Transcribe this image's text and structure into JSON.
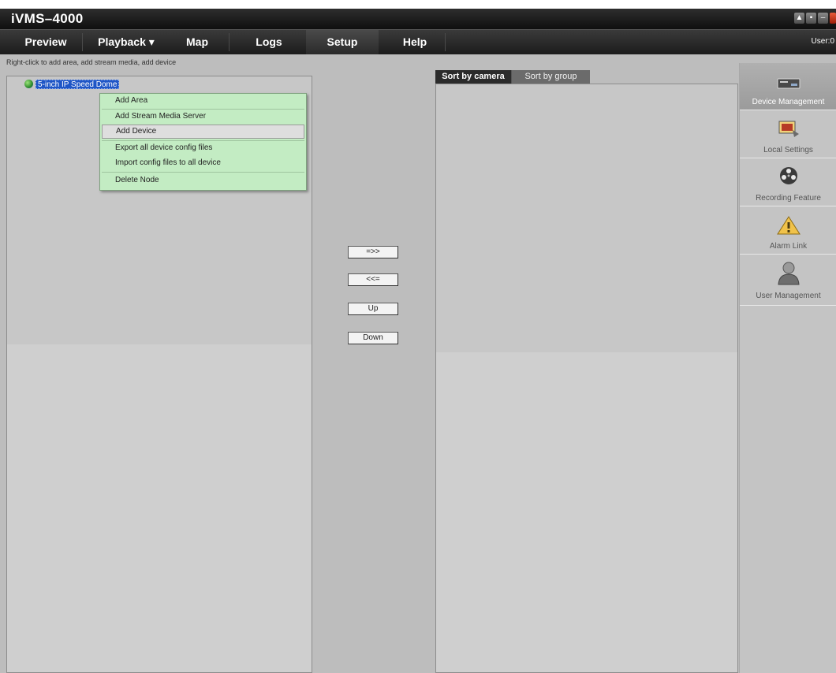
{
  "app": {
    "title": "iVMS–4000"
  },
  "menu": {
    "items": [
      {
        "label": "Preview"
      },
      {
        "label": "Playback ▾"
      },
      {
        "label": "Map"
      },
      {
        "label": "Logs"
      },
      {
        "label": "Setup"
      },
      {
        "label": "Help"
      }
    ],
    "active": "Setup",
    "user": "User:0"
  },
  "left_panel": {
    "hint": "Right-click to add area, add stream media, add device",
    "tree_node": "5-inch IP Speed Dome"
  },
  "context_menu": {
    "items": [
      {
        "label": "Add Area"
      },
      {
        "label": "Add Stream Media Server"
      },
      {
        "label": "Add Device"
      },
      {
        "label": "Export all device config files"
      },
      {
        "label": "Import config files to all device"
      },
      {
        "label": "Delete Node"
      }
    ],
    "hovered": "Add Device"
  },
  "middle_buttons": {
    "add": "=>>",
    "remove": "<<=",
    "up": "Up",
    "down": "Down"
  },
  "right_panel": {
    "tabs": [
      {
        "label": "Sort by camera"
      },
      {
        "label": "Sort by group"
      }
    ],
    "active_tab": "Sort by camera"
  },
  "sidebar": {
    "items": [
      {
        "label": "Device Management",
        "icon": "device-management-icon"
      },
      {
        "label": "Local Settings",
        "icon": "local-settings-icon"
      },
      {
        "label": "Recording Feature",
        "icon": "recording-feature-icon"
      },
      {
        "label": "Alarm Link",
        "icon": "alarm-link-icon"
      },
      {
        "label": "User Management",
        "icon": "user-management-icon"
      }
    ],
    "active": "Device Management"
  },
  "colors": {
    "menu_bg": "#1c1c1c",
    "selection": "#1f56c6",
    "context_menu_bg": "#c3ecc3",
    "panel_bg": "#cfcfcf"
  }
}
